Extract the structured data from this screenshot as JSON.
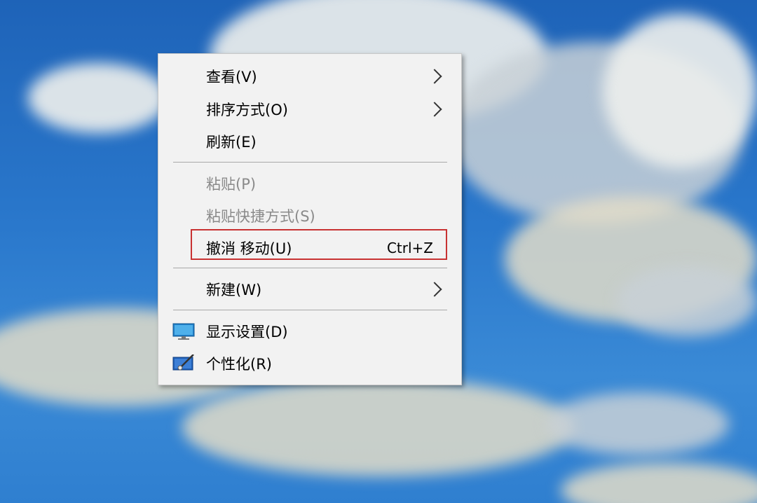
{
  "desktop": {
    "sky_color": "#2a78cc"
  },
  "context_menu": {
    "items": [
      {
        "label": "查看(V)",
        "has_submenu": true,
        "enabled": true
      },
      {
        "label": "排序方式(O)",
        "has_submenu": true,
        "enabled": true
      },
      {
        "label": "刷新(E)",
        "has_submenu": false,
        "enabled": true
      },
      {
        "label": "粘贴(P)",
        "has_submenu": false,
        "enabled": false
      },
      {
        "label": "粘贴快捷方式(S)",
        "has_submenu": false,
        "enabled": false
      },
      {
        "label": "撤消 移动(U)",
        "shortcut": "Ctrl+Z",
        "has_submenu": false,
        "enabled": true,
        "highlighted": true
      },
      {
        "label": "新建(W)",
        "has_submenu": true,
        "enabled": true
      },
      {
        "label": "显示设置(D)",
        "icon": "display-settings-icon",
        "has_submenu": false,
        "enabled": true
      },
      {
        "label": "个性化(R)",
        "icon": "personalize-icon",
        "has_submenu": false,
        "enabled": true
      }
    ],
    "highlight_color": "#c83232"
  }
}
